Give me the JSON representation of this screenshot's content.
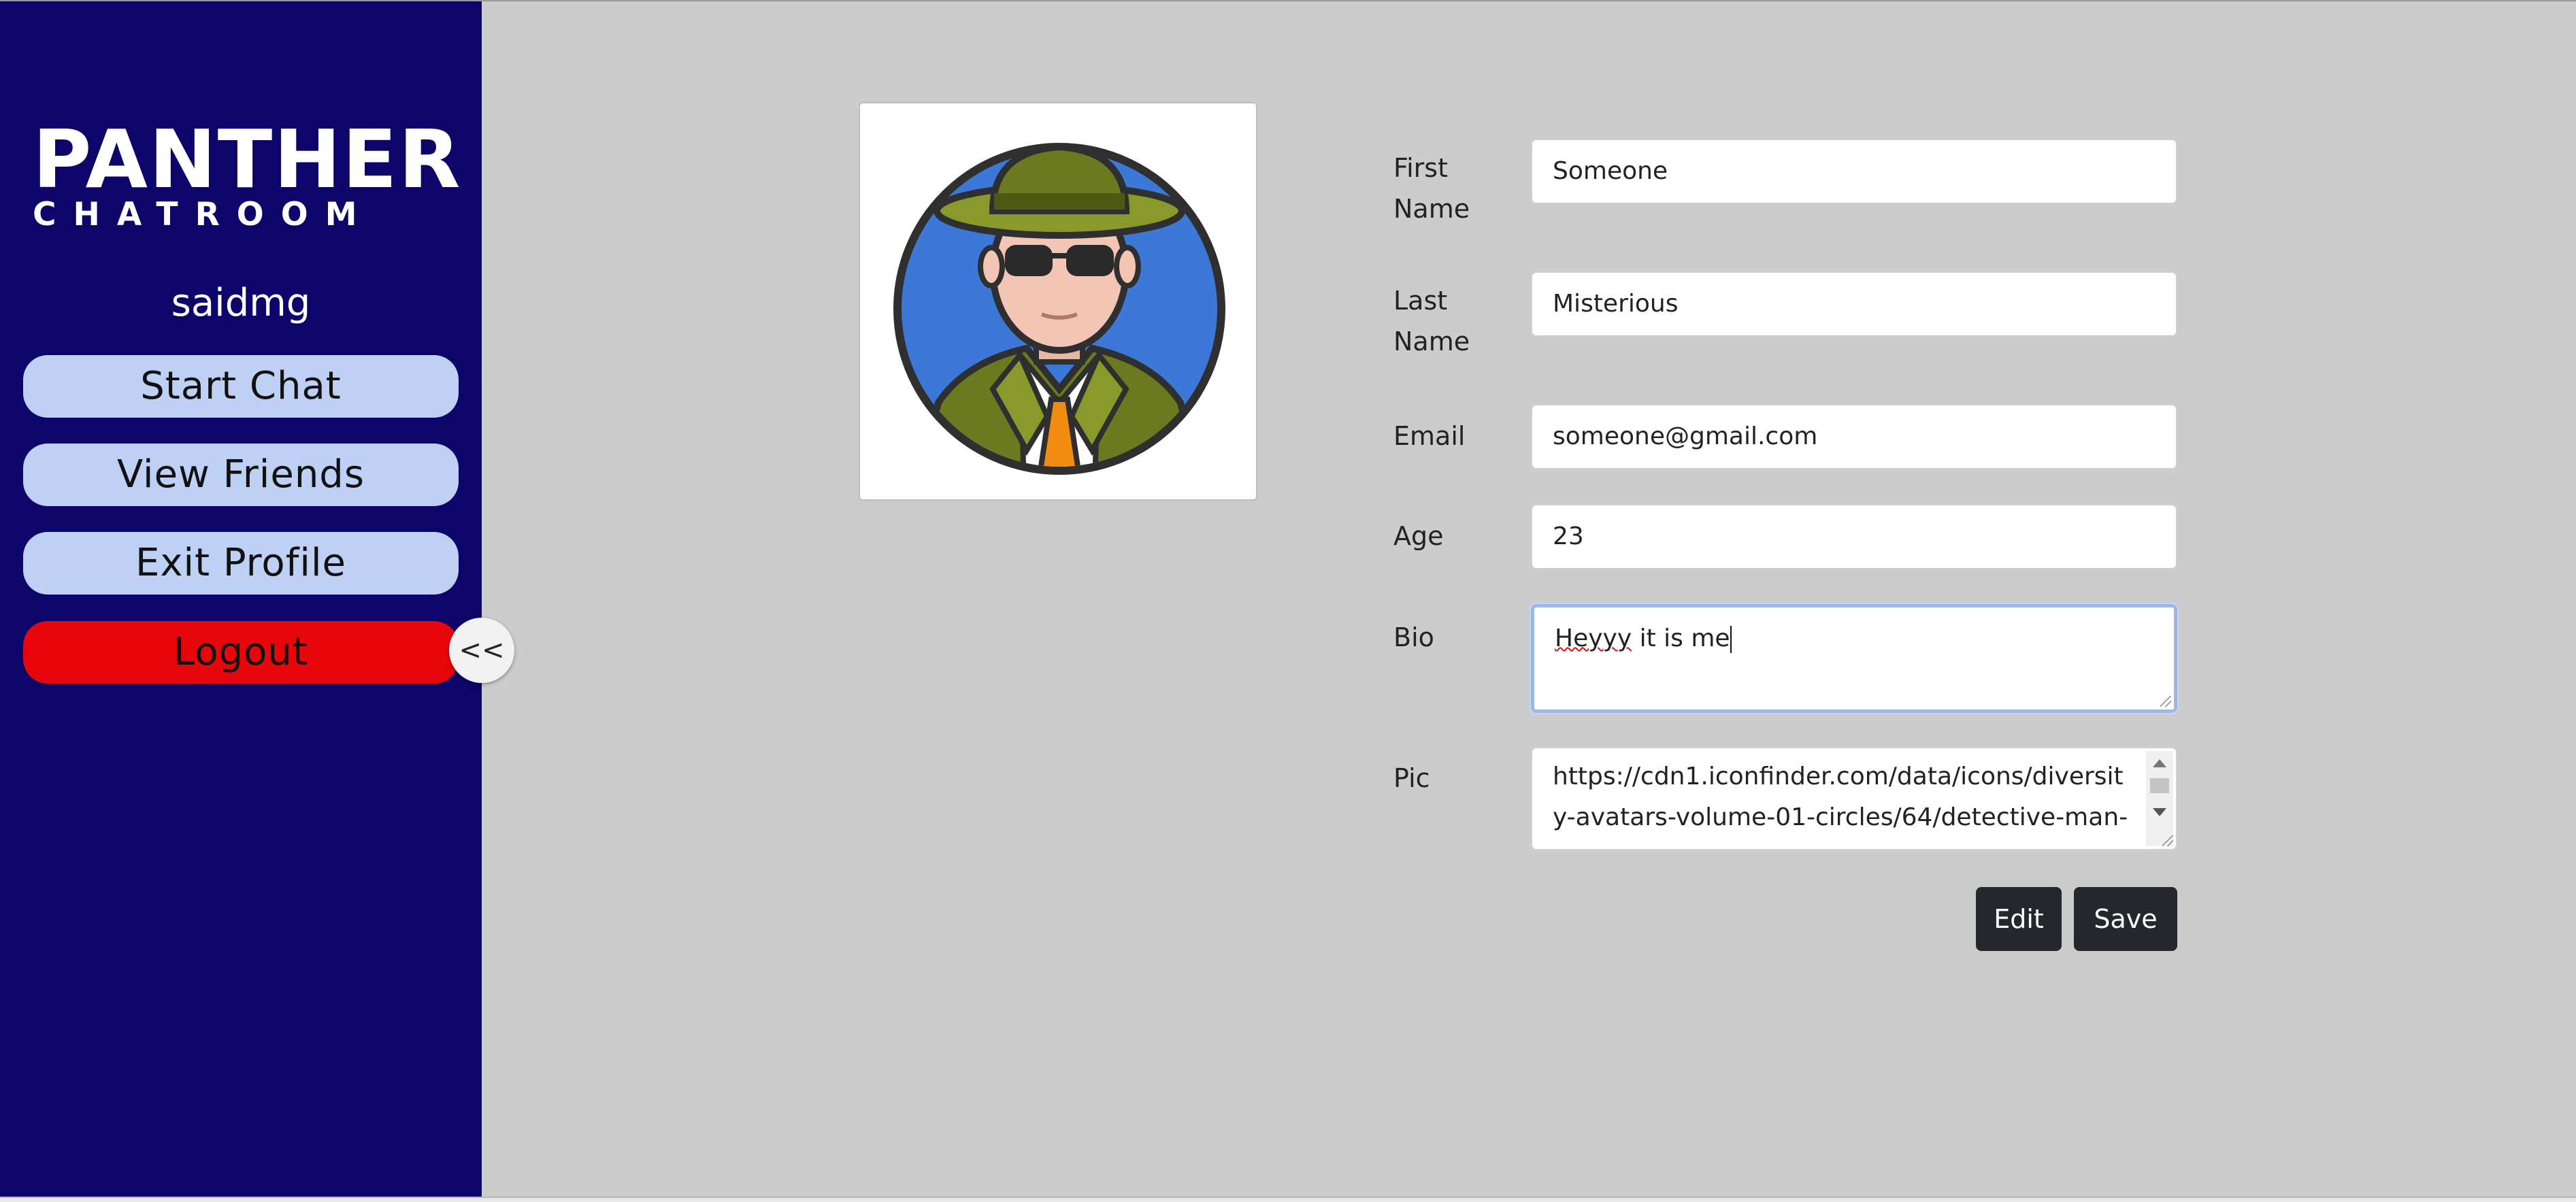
{
  "sidebar": {
    "logo": {
      "title": "PANTHER",
      "subtitle": "CHATROOM"
    },
    "username": "saidmg",
    "items": [
      {
        "label": "Start Chat"
      },
      {
        "label": "View Friends"
      },
      {
        "label": "Exit Profile"
      },
      {
        "label": "Logout"
      }
    ],
    "collapse_label": "<<"
  },
  "profile": {
    "avatar_icon": "detective-man-icon",
    "fields": {
      "first_name": {
        "label": "First Name",
        "value": "Someone"
      },
      "last_name": {
        "label": "Last Name",
        "value": "Misterious"
      },
      "email": {
        "label": "Email",
        "value": "someone@gmail.com"
      },
      "age": {
        "label": "Age",
        "value": "23"
      },
      "bio": {
        "label": "Bio",
        "value_underlined": "Heyyy",
        "value_rest": " it is me"
      },
      "pic": {
        "label": "Pic",
        "value": "https://cdn1.iconfinder.com/data/icons/diversity-avatars-volume-01-circles/64/detective-man-"
      }
    },
    "actions": {
      "edit_label": "Edit",
      "save_label": "Save"
    }
  },
  "colors": {
    "sidebar_bg": "#0d056a",
    "nav_button": "#bfd0f5",
    "logout_button": "#e6060b",
    "page_bg": "#cccccc",
    "action_button": "#24282c"
  }
}
